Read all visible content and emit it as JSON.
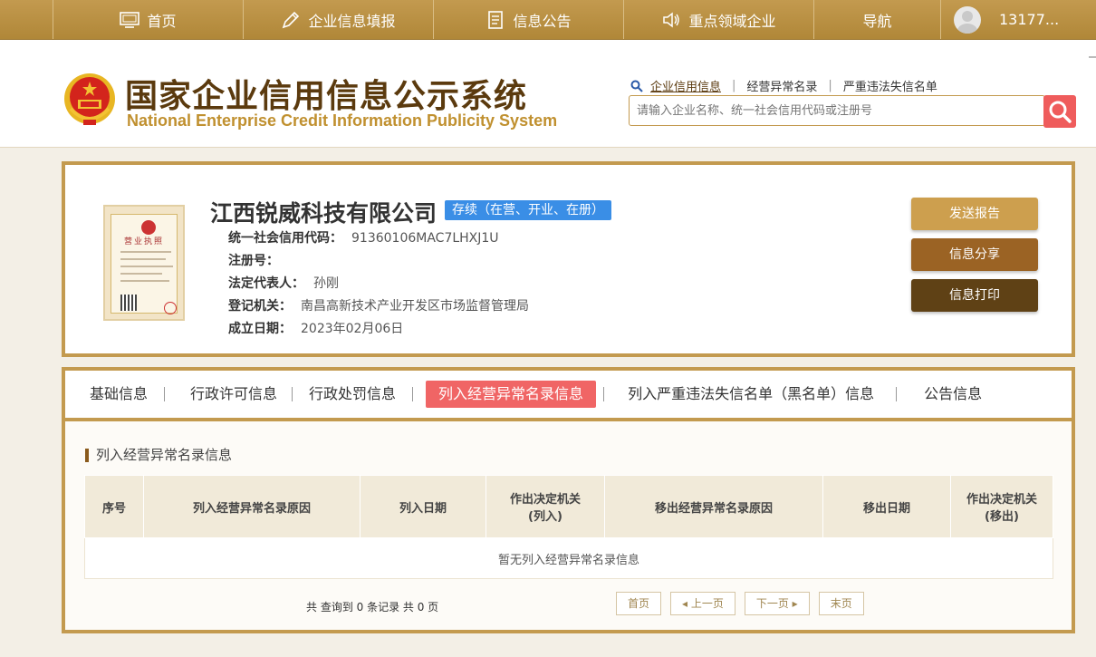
{
  "topnav": {
    "items": [
      {
        "label": "首页",
        "icon": "monitor-icon"
      },
      {
        "label": "企业信息填报",
        "icon": "edit-icon"
      },
      {
        "label": "信息公告",
        "icon": "document-icon"
      },
      {
        "label": "重点领域企业",
        "icon": "speaker-icon"
      },
      {
        "label": "导航",
        "icon": ""
      }
    ],
    "user": "13177..."
  },
  "header": {
    "title_cn": "国家企业信用信息公示系统",
    "title_en": "National Enterprise Credit Information Publicity System",
    "quicklinks": [
      "企业信用信息",
      "经营异常名录",
      "严重违法失信名单"
    ],
    "search_placeholder": "请输入企业名称、统一社会信用代码或注册号"
  },
  "company": {
    "name": "江西锐威科技有限公司",
    "status": "存续（在营、开业、在册）",
    "license_label": "营业执照",
    "fields": [
      {
        "key": "统一社会信用代码：",
        "value": "91360106MAC7LHXJ1U"
      },
      {
        "key": "注册号：",
        "value": ""
      },
      {
        "key": "法定代表人：",
        "value": "孙刚"
      },
      {
        "key": "登记机关：",
        "value": "南昌高新技术产业开发区市场监督管理局"
      },
      {
        "key": "成立日期：",
        "value": "2023年02月06日"
      }
    ],
    "buttons": {
      "send": "发送报告",
      "share": "信息分享",
      "print": "信息打印"
    }
  },
  "tabs": [
    "基础信息",
    "行政许可信息",
    "行政处罚信息",
    "列入经营异常名录信息",
    "列入严重违法失信名单（黑名单）信息",
    "公告信息"
  ],
  "active_tab": 3,
  "section": {
    "title": "列入经营异常名录信息",
    "columns": [
      "序号",
      "列入经营异常名录原因",
      "列入日期",
      "作出决定机关\n(列入)",
      "移出经营异常名录原因",
      "移出日期",
      "作出决定机关\n(移出)"
    ],
    "empty_text": "暂无列入经营异常名录信息",
    "page_info": "共 查询到 0 条记录 共 0 页",
    "pager": {
      "first": "首页",
      "prev": "◂ 上一页",
      "next": "下一页 ▸",
      "last": "末页"
    }
  },
  "colors": {
    "gold": "#c39a4f",
    "active_tab": "#f06565",
    "status": "#3a8ee6"
  }
}
